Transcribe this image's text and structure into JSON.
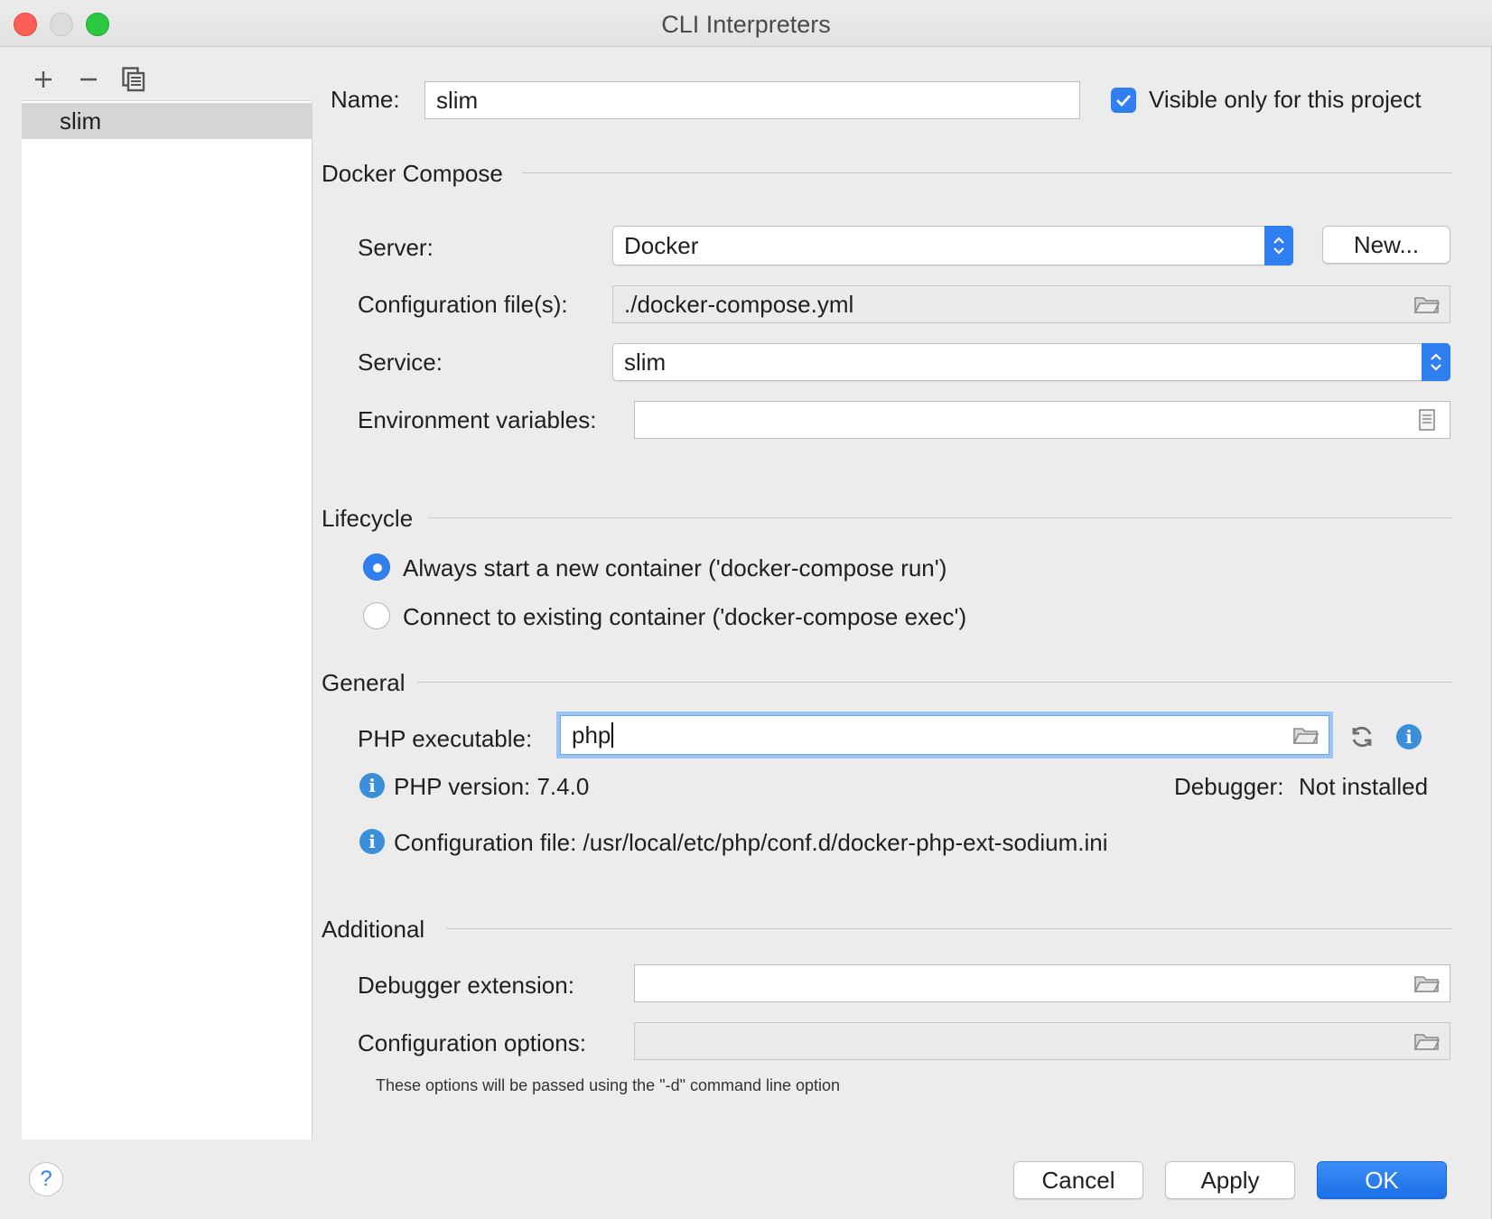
{
  "window": {
    "title": "CLI Interpreters"
  },
  "left_panel": {
    "toolbar": {
      "add_icon": "plus-icon",
      "remove_icon": "minus-icon",
      "copy_icon": "copy-icon"
    },
    "items": [
      {
        "label": "slim"
      }
    ]
  },
  "name_row": {
    "label": "Name:",
    "value": "slim",
    "visible_only_label": "Visible only for this project",
    "visible_only_checked": true
  },
  "docker_compose": {
    "section_title": "Docker Compose",
    "server_label": "Server:",
    "server_value": "Docker",
    "new_button": "New...",
    "config_label": "Configuration file(s):",
    "config_value": "./docker-compose.yml",
    "service_label": "Service:",
    "service_value": "slim",
    "env_label": "Environment variables:",
    "env_value": ""
  },
  "lifecycle": {
    "section_title": "Lifecycle",
    "options": [
      {
        "label": "Always start a new container ('docker-compose run')",
        "selected": true
      },
      {
        "label": "Connect to existing container ('docker-compose exec')",
        "selected": false
      }
    ]
  },
  "general": {
    "section_title": "General",
    "php_exec_label": "PHP executable:",
    "php_exec_value": "php",
    "php_version": "PHP version: 7.4.0",
    "debugger_label": "Debugger:",
    "debugger_value": "Not installed",
    "config_file": "Configuration file: /usr/local/etc/php/conf.d/docker-php-ext-sodium.ini"
  },
  "additional": {
    "section_title": "Additional",
    "debugger_ext_label": "Debugger extension:",
    "debugger_ext_value": "",
    "config_options_label": "Configuration options:",
    "config_options_value": "",
    "hint": "These options will be passed using the \"-d\" command line option"
  },
  "footer": {
    "help": "?",
    "cancel": "Cancel",
    "apply": "Apply",
    "ok": "OK"
  },
  "colors": {
    "accent": "#2f7ff0",
    "info": "#3a8fd8",
    "close": "#fd5f57",
    "maximize": "#2bc840"
  }
}
